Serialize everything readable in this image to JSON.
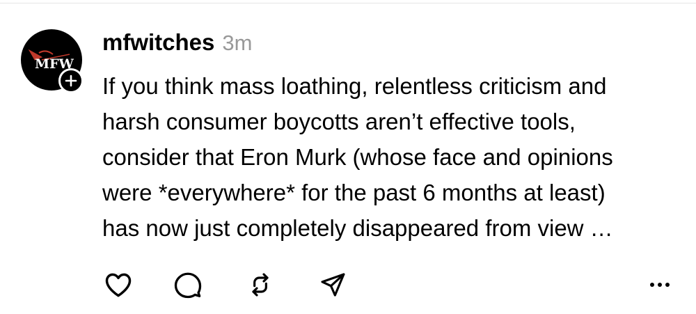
{
  "post": {
    "avatar_text": "MFW",
    "username": "mfwitches",
    "timestamp": "3m",
    "body_lines": [
      "If you think mass loathing, relentless criticism and",
      "harsh consumer boycotts aren’t effective tools,",
      "consider that Eron Murk (whose face and opinions",
      "were *everywhere* for the past 6 months at least)",
      "has now just completely disappeared from view …"
    ]
  },
  "icons": {
    "avatar": "mfw-logo",
    "follow": "plus-icon",
    "like": "heart-icon",
    "reply": "comment-icon",
    "repost": "repost-icon",
    "share": "send-icon",
    "more": "more-icon"
  },
  "colors": {
    "text": "#000000",
    "timestamp": "#999999",
    "avatar_bg": "#000000",
    "logo_accent": "#c0392b"
  }
}
